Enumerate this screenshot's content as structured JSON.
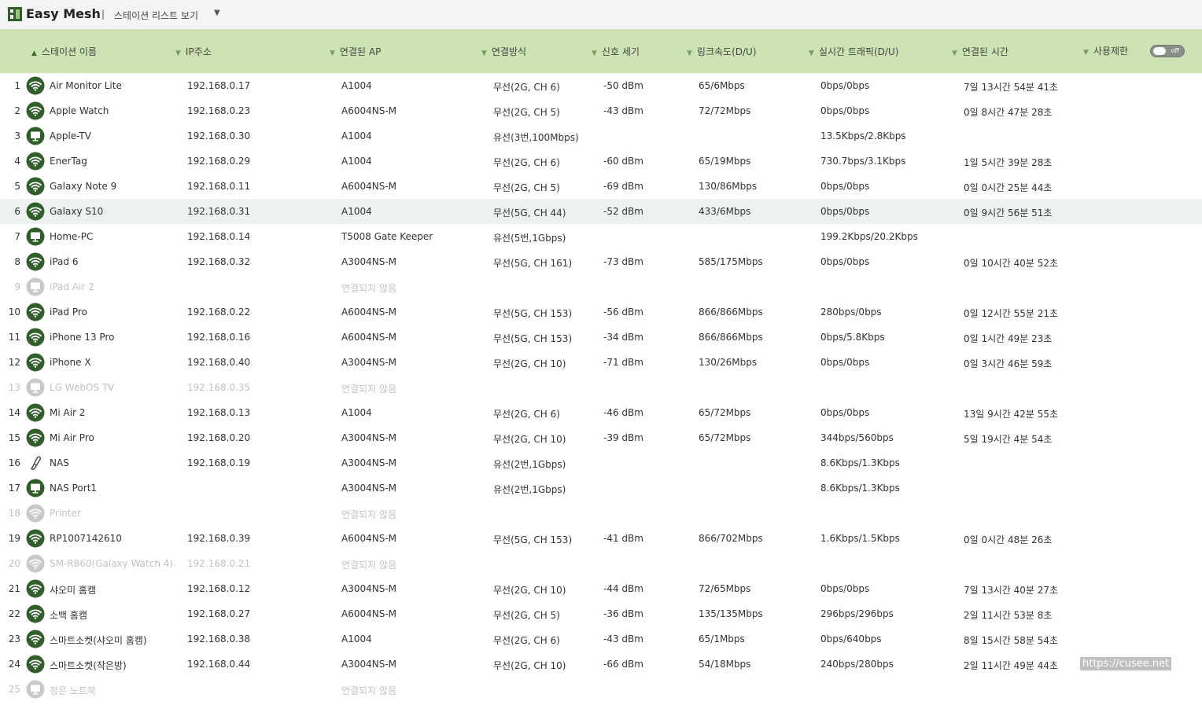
{
  "app": {
    "title": "Easy Mesh",
    "separator": "|",
    "view_label": "스테이션 리스트 보기",
    "view_caret": "▼"
  },
  "colors": {
    "header_bg": "#cde3b3",
    "icon_active": "#2f5e2a",
    "icon_disabled": "#c9c9c9",
    "row_highlight": "#eef2ee"
  },
  "columns": {
    "name": "스테이션 이름",
    "ip": "IP주소",
    "ap": "연결된 AP",
    "mode": "연결방식",
    "signal": "신호 세기",
    "link": "링크속도(D/U)",
    "traffic": "실시간 트래픽(D/U)",
    "time": "연결된 시간",
    "limit": "사용제한",
    "toggle": "off"
  },
  "rows": [
    {
      "num": "1",
      "icon": "wifi-icon",
      "name": "Air Monitor Lite",
      "ip": "192.168.0.17",
      "ap": "A1004",
      "mode": "무선(2G, CH 6)",
      "signal": "-50 dBm",
      "link": "65/6Mbps",
      "traffic": "0bps/0bps",
      "time": "7일 13시간 54분 41초"
    },
    {
      "num": "2",
      "icon": "wifi-icon",
      "name": "Apple Watch",
      "ip": "192.168.0.23",
      "ap": "A6004NS-M",
      "mode": "무선(2G, CH 5)",
      "signal": "-43 dBm",
      "link": "72/72Mbps",
      "traffic": "0bps/0bps",
      "time": "0일 8시간 47분 28초"
    },
    {
      "num": "3",
      "icon": "monitor-icon",
      "name": "Apple-TV",
      "ip": "192.168.0.30",
      "ap": "A1004",
      "mode": "유선(3번,100Mbps)",
      "signal": "",
      "link": "",
      "traffic": "13.5Kbps/2.8Kbps",
      "time": ""
    },
    {
      "num": "4",
      "icon": "wifi-icon",
      "name": "EnerTag",
      "ip": "192.168.0.29",
      "ap": "A1004",
      "mode": "무선(2G, CH 6)",
      "signal": "-60 dBm",
      "link": "65/19Mbps",
      "traffic": "730.7bps/3.1Kbps",
      "time": "1일 5시간 39분 28초"
    },
    {
      "num": "5",
      "icon": "wifi-icon",
      "name": "Galaxy Note 9",
      "ip": "192.168.0.11",
      "ap": "A6004NS-M",
      "mode": "무선(2G, CH 5)",
      "signal": "-69 dBm",
      "link": "130/86Mbps",
      "traffic": "0bps/0bps",
      "time": "0일 0시간 25분 44초"
    },
    {
      "num": "6",
      "icon": "wifi-icon",
      "name": "Galaxy S10",
      "ip": "192.168.0.31",
      "ap": "A1004",
      "mode": "무선(5G, CH 44)",
      "signal": "-52 dBm",
      "link": "433/6Mbps",
      "traffic": "0bps/0bps",
      "time": "0일 9시간 56분 51초",
      "highlight": true
    },
    {
      "num": "7",
      "icon": "monitor-icon",
      "name": "Home-PC",
      "ip": "192.168.0.14",
      "ap": "T5008 Gate Keeper",
      "mode": "유선(5번,1Gbps)",
      "signal": "",
      "link": "",
      "traffic": "199.2Kbps/20.2Kbps",
      "time": ""
    },
    {
      "num": "8",
      "icon": "wifi-icon",
      "name": "iPad 6",
      "ip": "192.168.0.32",
      "ap": "A3004NS-M",
      "mode": "무선(5G, CH 161)",
      "signal": "-73 dBm",
      "link": "585/175Mbps",
      "traffic": "0bps/0bps",
      "time": "0일 10시간 40분 52초"
    },
    {
      "num": "9",
      "icon": "monitor-icon",
      "name": "iPad Air 2",
      "ip": "",
      "ap": "연결되지 않음",
      "mode": "",
      "signal": "",
      "link": "",
      "traffic": "",
      "time": "",
      "disabled": true
    },
    {
      "num": "10",
      "icon": "wifi-icon",
      "name": "iPad Pro",
      "ip": "192.168.0.22",
      "ap": "A6004NS-M",
      "mode": "무선(5G, CH 153)",
      "signal": "-56 dBm",
      "link": "866/866Mbps",
      "traffic": "280bps/0bps",
      "time": "0일 12시간 55분 21초"
    },
    {
      "num": "11",
      "icon": "wifi-icon",
      "name": "iPhone 13 Pro",
      "ip": "192.168.0.16",
      "ap": "A6004NS-M",
      "mode": "무선(5G, CH 153)",
      "signal": "-34 dBm",
      "link": "866/866Mbps",
      "traffic": "0bps/5.8Kbps",
      "time": "0일 1시간 49분 23초"
    },
    {
      "num": "12",
      "icon": "wifi-icon",
      "name": "iPhone X",
      "ip": "192.168.0.40",
      "ap": "A3004NS-M",
      "mode": "무선(2G, CH 10)",
      "signal": "-71 dBm",
      "link": "130/26Mbps",
      "traffic": "0bps/0bps",
      "time": "0일 3시간 46분 59초"
    },
    {
      "num": "13",
      "icon": "monitor-icon",
      "name": "LG WebOS TV",
      "ip": "192.168.0.35",
      "ap": "연결되지 않음",
      "mode": "",
      "signal": "",
      "link": "",
      "traffic": "",
      "time": "",
      "disabled": true
    },
    {
      "num": "14",
      "icon": "wifi-icon",
      "name": "Mi Air 2",
      "ip": "192.168.0.13",
      "ap": "A1004",
      "mode": "무선(2G, CH 6)",
      "signal": "-46 dBm",
      "link": "65/72Mbps",
      "traffic": "0bps/0bps",
      "time": "13일 9시간 42분 55초"
    },
    {
      "num": "15",
      "icon": "wifi-icon",
      "name": "Mi Air Pro",
      "ip": "192.168.0.20",
      "ap": "A3004NS-M",
      "mode": "무선(2G, CH 10)",
      "signal": "-39 dBm",
      "link": "65/72Mbps",
      "traffic": "344bps/560bps",
      "time": "5일 19시간 4분 54초"
    },
    {
      "num": "16",
      "icon": "cable-icon",
      "name": "NAS",
      "ip": "192.168.0.19",
      "ap": "A3004NS-M",
      "mode": "유선(2번,1Gbps)",
      "signal": "",
      "link": "",
      "traffic": "8.6Kbps/1.3Kbps",
      "time": ""
    },
    {
      "num": "17",
      "icon": "monitor-icon",
      "name": "NAS Port1",
      "ip": "",
      "ap": "A3004NS-M",
      "mode": "유선(2번,1Gbps)",
      "signal": "",
      "link": "",
      "traffic": "8.6Kbps/1.3Kbps",
      "time": ""
    },
    {
      "num": "18",
      "icon": "wifi-icon",
      "name": "Printer",
      "ip": "",
      "ap": "연결되지 않음",
      "mode": "",
      "signal": "",
      "link": "",
      "traffic": "",
      "time": "",
      "disabled": true
    },
    {
      "num": "19",
      "icon": "wifi-icon",
      "name": "RP1007142610",
      "ip": "192.168.0.39",
      "ap": "A6004NS-M",
      "mode": "무선(5G, CH 153)",
      "signal": "-41 dBm",
      "link": "866/702Mbps",
      "traffic": "1.6Kbps/1.5Kbps",
      "time": "0일 0시간 48분 26초"
    },
    {
      "num": "20",
      "icon": "wifi-icon",
      "name": "SM-R860(Galaxy Watch 4)",
      "ip": "192.168.0.21",
      "ap": "연결되지 않음",
      "mode": "",
      "signal": "",
      "link": "",
      "traffic": "",
      "time": "",
      "disabled": true
    },
    {
      "num": "21",
      "icon": "wifi-icon",
      "name": "샤오미 홈캠",
      "ip": "192.168.0.12",
      "ap": "A3004NS-M",
      "mode": "무선(2G, CH 10)",
      "signal": "-44 dBm",
      "link": "72/65Mbps",
      "traffic": "0bps/0bps",
      "time": "7일 13시간 40분 27초"
    },
    {
      "num": "22",
      "icon": "wifi-icon",
      "name": "소백 홈캠",
      "ip": "192.168.0.27",
      "ap": "A6004NS-M",
      "mode": "무선(2G, CH 5)",
      "signal": "-36 dBm",
      "link": "135/135Mbps",
      "traffic": "296bps/296bps",
      "time": "2일 11시간 53분 8초"
    },
    {
      "num": "23",
      "icon": "wifi-icon",
      "name": "스마트소켓(샤오미 홈캠)",
      "ip": "192.168.0.38",
      "ap": "A1004",
      "mode": "무선(2G, CH 6)",
      "signal": "-43 dBm",
      "link": "65/1Mbps",
      "traffic": "0bps/640bps",
      "time": "8일 15시간 58분 54초"
    },
    {
      "num": "24",
      "icon": "wifi-icon",
      "name": "스마트소켓(작은방)",
      "ip": "192.168.0.44",
      "ap": "A3004NS-M",
      "mode": "무선(2G, CH 10)",
      "signal": "-66 dBm",
      "link": "54/18Mbps",
      "traffic": "240bps/280bps",
      "time": "2일 11시간 49분 44초"
    },
    {
      "num": "25",
      "icon": "monitor-icon",
      "name": "정은 노트북",
      "ip": "",
      "ap": "연결되지 않음",
      "mode": "",
      "signal": "",
      "link": "",
      "traffic": "",
      "time": "",
      "disabled": true
    }
  ],
  "watermark": "https://cusee.net"
}
